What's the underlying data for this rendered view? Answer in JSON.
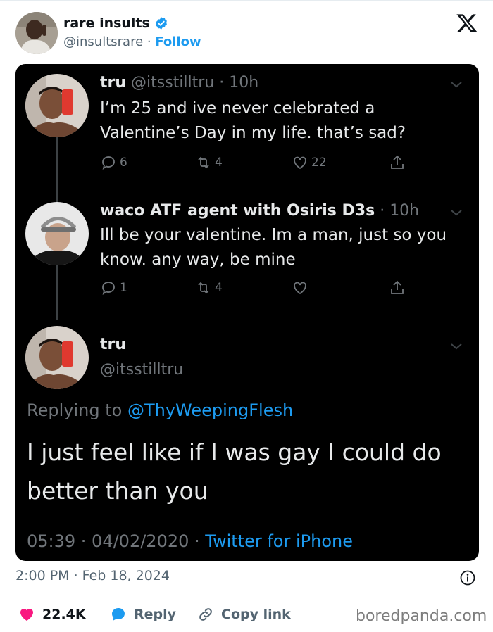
{
  "author": {
    "name": "rare insults",
    "handle": "@insultsrare",
    "separator": "·",
    "follow_label": "Follow"
  },
  "embedded": {
    "tweet1": {
      "name": "tru",
      "meta": "@itsstilltru · 10h",
      "text": "I’m 25 and ive never celebrated a Valentine’s Day in my life. that’s sad?",
      "replies": "6",
      "retweets": "4",
      "likes": "22"
    },
    "tweet2": {
      "name": "waco ATF agent with Osiris D3s",
      "meta": "· 10h",
      "text": "Ill be your valentine. Im a man, just so you know. any way, be mine",
      "replies": "1",
      "retweets": "4"
    },
    "tweet3": {
      "name": "tru",
      "handle": "@itsstilltru",
      "replying_prefix": "Replying to",
      "replying_handle": "@ThyWeepingFlesh",
      "text": "I just feel like if I was gay I could do better than you",
      "time_date": "05:39 · 04/02/2020 ·",
      "source": "Twitter for iPhone"
    }
  },
  "footer": {
    "timestamp": "2:00 PM · Feb 18, 2024",
    "likes": "22.4K",
    "reply_label": "Reply",
    "copy_label": "Copy link",
    "watermark": "boredpanda.com"
  },
  "colors": {
    "accent": "#1d9bf0",
    "like": "#f91880",
    "embed_bg": "#000000",
    "muted": "#536471"
  }
}
